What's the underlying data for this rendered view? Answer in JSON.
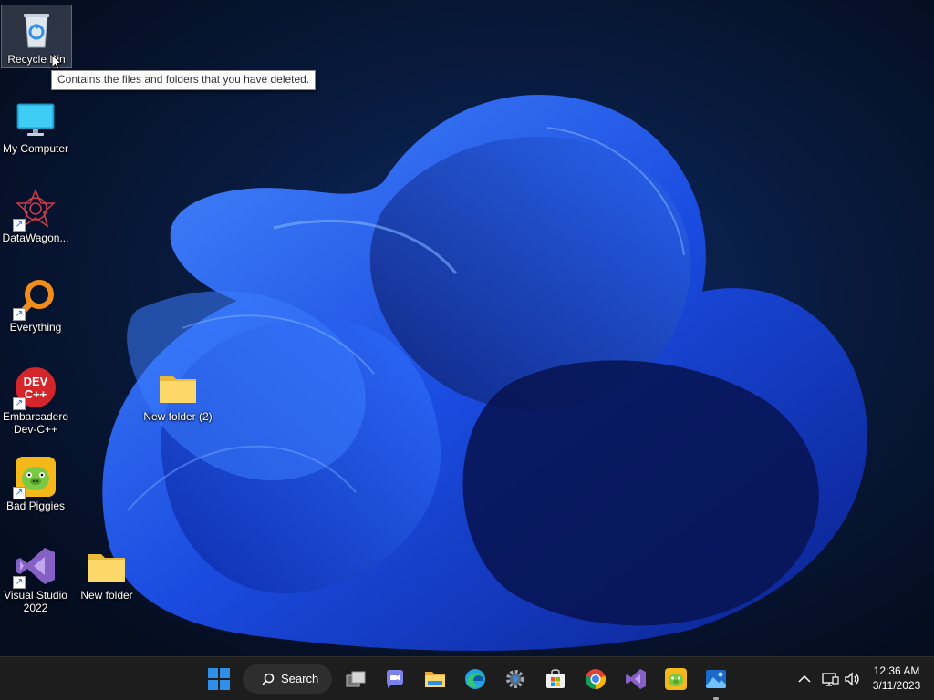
{
  "desktop": {
    "icons": [
      {
        "label": "Recycle Bin",
        "icon": "recycle-bin-icon"
      },
      {
        "label": "My Computer",
        "icon": "monitor-icon"
      },
      {
        "label": "DataWagon...",
        "icon": "datawagon-icon"
      },
      {
        "label": "Everything",
        "icon": "everything-search-icon"
      },
      {
        "label": "Embarcadero Dev-C++",
        "icon": "devcpp-icon"
      },
      {
        "label": "Bad Piggies",
        "icon": "bad-piggies-icon"
      },
      {
        "label": "Visual Studio 2022",
        "icon": "visual-studio-icon"
      },
      {
        "label": "New folder",
        "icon": "folder-icon"
      },
      {
        "label": "New folder (2)",
        "icon": "folder-icon"
      }
    ],
    "tooltip": "Contains the files and folders that you have deleted.",
    "devcpp_badge_top": "DEV",
    "devcpp_badge_bottom": "C++"
  },
  "taskbar": {
    "search_label": "Search",
    "apps": [
      {
        "name": "start-button",
        "icon": "windows-logo-icon"
      },
      {
        "name": "task-view",
        "icon": "task-view-icon"
      },
      {
        "name": "teams-chat",
        "icon": "teams-chat-icon"
      },
      {
        "name": "file-explorer",
        "icon": "file-explorer-icon"
      },
      {
        "name": "edge",
        "icon": "edge-icon"
      },
      {
        "name": "settings",
        "icon": "settings-gear-icon"
      },
      {
        "name": "microsoft-store",
        "icon": "store-icon"
      },
      {
        "name": "chrome",
        "icon": "chrome-icon"
      },
      {
        "name": "visual-studio",
        "icon": "visual-studio-icon"
      },
      {
        "name": "bad-piggies",
        "icon": "bad-piggies-icon"
      },
      {
        "name": "photos",
        "icon": "photos-icon"
      }
    ],
    "tray": {
      "icons": [
        "chevron-up-icon",
        "network-icon",
        "volume-icon"
      ],
      "time": "12:36 AM",
      "date": "3/11/2023"
    }
  },
  "colors": {
    "wallpaper_dark": "#06122a",
    "bloom_blue": "#1f55e6",
    "taskbar": "#1d1d1d",
    "windows_blue": "#2f8fe8"
  }
}
